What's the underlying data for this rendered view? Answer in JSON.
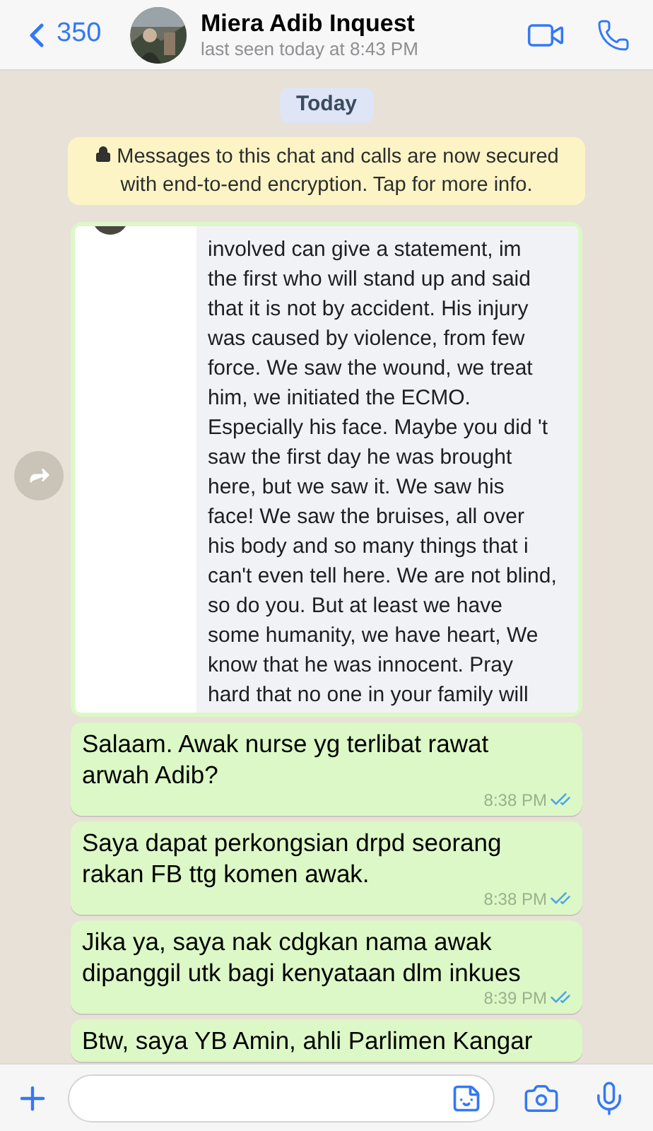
{
  "header": {
    "back_label": "350",
    "contact_name": "Miera Adib Inquest",
    "status": "last seen today at 8:43 PM"
  },
  "date_pill": "Today",
  "encryption_notice": "Messages to this chat and calls are now secured with end-to-end encryption. Tap for more info.",
  "messages": [
    {
      "lines": [
        "involved can give a statement, im",
        "the first who will stand up and said",
        "that it is not by accident. His injury",
        "was caused by violence, from few",
        "force. We saw the wound, we treat",
        "him, we initiated the ECMO.",
        "Especially his face. Maybe you did 't",
        "saw the first day he was brought",
        "here, but we saw it. We saw his",
        "face! We saw the bruises, all over",
        "his body and so many things that i",
        "can't even tell here. We are not blind,",
        "so do you. But at least we have",
        "some humanity, we have heart, We",
        "know that he was innocent. Pray",
        "hard that no one in your family will"
      ]
    },
    {
      "kind": "text",
      "text": "Salaam. Awak nurse yg terlibat rawat arwah Adib?",
      "time": "8:38 PM",
      "read": true
    },
    {
      "kind": "text",
      "text": "Saya dapat perkongsian drpd seorang rakan FB ttg komen awak.",
      "time": "8:38 PM",
      "read": true
    },
    {
      "kind": "text",
      "text": "Jika ya, saya nak cdgkan nama awak dipanggil utk bagi kenyataan dlm inkues",
      "time": "8:39 PM",
      "read": true
    },
    {
      "kind": "text",
      "text": "Btw, saya YB Amin, ahli Parlimen Kangar"
    }
  ]
}
